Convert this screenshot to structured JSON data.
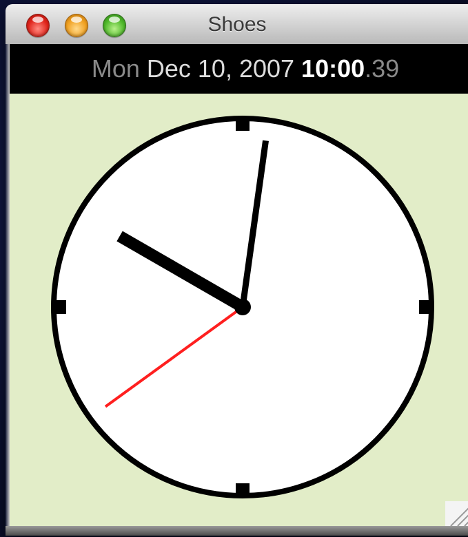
{
  "window": {
    "title": "Shoes",
    "buttons": {
      "close": "close-button",
      "minimize": "minimize-button",
      "zoom": "zoom-button"
    }
  },
  "datebar": {
    "day": "Mon",
    "date": "Dec 10, 2007",
    "time": "10:00",
    "centiseconds": ".39"
  },
  "clock": {
    "hour": 10,
    "minute": 0,
    "second": 39,
    "face_color": "#ffffff",
    "rim_color": "#000000",
    "hand_color": "#000000",
    "second_hand_color": "#ff1f1f",
    "background_color": "#e2edc8"
  },
  "icons": {
    "resize": "resize-grip-icon"
  }
}
